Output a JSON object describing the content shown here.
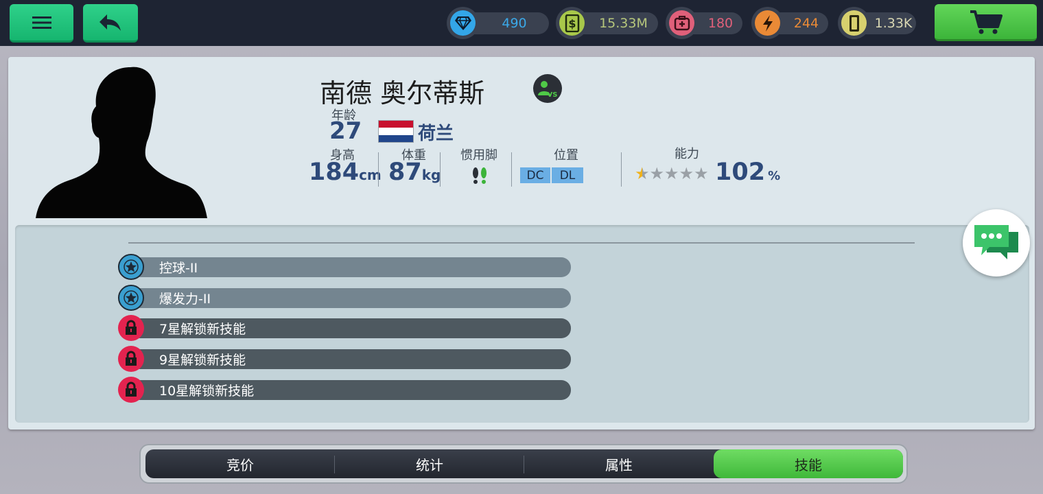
{
  "topbar": {
    "resources": [
      {
        "id": "gems",
        "value": "490",
        "color": "#33a6e8",
        "text_color": "#3ba8e8"
      },
      {
        "id": "cash",
        "value": "15.33M",
        "color": "#a8c84a",
        "text_color": "#b7c77c"
      },
      {
        "id": "medkit",
        "value": "180",
        "color": "#e0607a",
        "text_color": "#e0607a"
      },
      {
        "id": "energy",
        "value": "244",
        "color": "#ea8a36",
        "text_color": "#ea8a36"
      },
      {
        "id": "cards",
        "value": "1.33K",
        "color": "#d7d06e",
        "text_color": "#d9d7b3"
      }
    ]
  },
  "player": {
    "name": "南德 奥尔蒂斯",
    "age_label": "年龄",
    "age": "27",
    "country": "荷兰",
    "height_label": "身高",
    "height": "184",
    "height_unit": "cm",
    "weight_label": "体重",
    "weight": "87",
    "weight_unit": "kg",
    "foot_label": "惯用脚",
    "position_label": "位置",
    "positions": [
      "DC",
      "DL"
    ],
    "ability_label": "能力",
    "ability": "102",
    "ability_unit": "%",
    "stars_total": 5,
    "stars_filled": 0.5
  },
  "skills": [
    {
      "label": "控球-II",
      "state": "unlocked"
    },
    {
      "label": "爆发力-II",
      "state": "unlocked"
    },
    {
      "label": "7星解锁新技能",
      "state": "locked"
    },
    {
      "label": "9星解锁新技能",
      "state": "locked"
    },
    {
      "label": "10星解锁新技能",
      "state": "locked"
    }
  ],
  "tabs": [
    {
      "label": "竞价",
      "active": false
    },
    {
      "label": "统计",
      "active": false
    },
    {
      "label": "属性",
      "active": false
    },
    {
      "label": "技能",
      "active": true
    }
  ],
  "colors": {
    "accent_green": "#2fd18a",
    "tab_active": "#4fc947",
    "stat_blue": "#2e4a7a",
    "unlocked_icon": "#3a9fd0",
    "locked_icon": "#e3234f"
  }
}
